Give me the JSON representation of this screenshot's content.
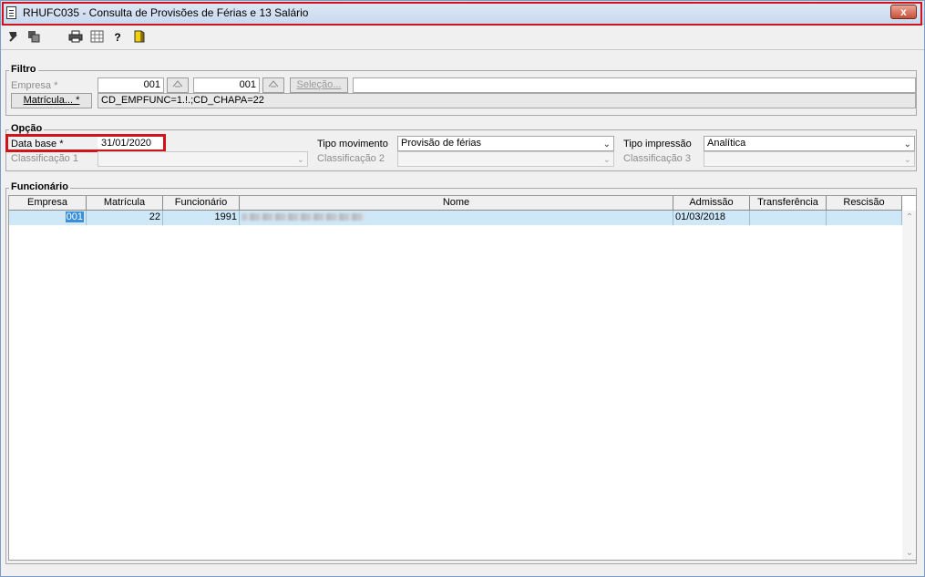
{
  "window": {
    "title": "RHUFC035 - Consulta de Provisões de Férias e 13 Salário",
    "close_symbol": "x"
  },
  "toolbar": {
    "icons": [
      "arrow-icon",
      "copy-icon",
      "print-icon",
      "grid-icon",
      "help-icon",
      "exit-icon"
    ]
  },
  "filtro": {
    "group_label": "Filtro",
    "empresa_label": "Empresa *",
    "empresa_from": "001",
    "empresa_to": "001",
    "selecao_label": "Seleção...",
    "selecao_value": "",
    "matricula_button": "Matrícula... *",
    "matricula_value": "CD_EMPFUNC=1.!.;CD_CHAPA=22"
  },
  "opcao": {
    "group_label": "Opção",
    "data_base_label": "Data base *",
    "data_base_value": "31/01/2020",
    "tipo_movimento_label": "Tipo movimento",
    "tipo_movimento_value": "Provisão de férias",
    "tipo_impressao_label": "Tipo impressão",
    "tipo_impressao_value": "Analítica",
    "classificacao1_label": "Classificação 1",
    "classificacao2_label": "Classificação 2",
    "classificacao3_label": "Classificação 3",
    "classificacao1_value": "",
    "classificacao2_value": "",
    "classificacao3_value": ""
  },
  "funcionario": {
    "group_label": "Funcionário",
    "columns": {
      "empresa": "Empresa",
      "matricula": "Matrícula",
      "funcionario": "Funcionário",
      "nome": "Nome",
      "admissao": "Admissão",
      "transferencia": "Transferência",
      "rescisao": "Rescisão"
    },
    "rows": [
      {
        "empresa": "001",
        "matricula": "22",
        "funcionario": "1991",
        "admissao": "01/03/2018",
        "transferencia": "",
        "rescisao": ""
      }
    ]
  },
  "colors": {
    "highlight": "#d0141c",
    "row_selected": "#cfe8f7",
    "cell_selected": "#3b8fd9"
  }
}
